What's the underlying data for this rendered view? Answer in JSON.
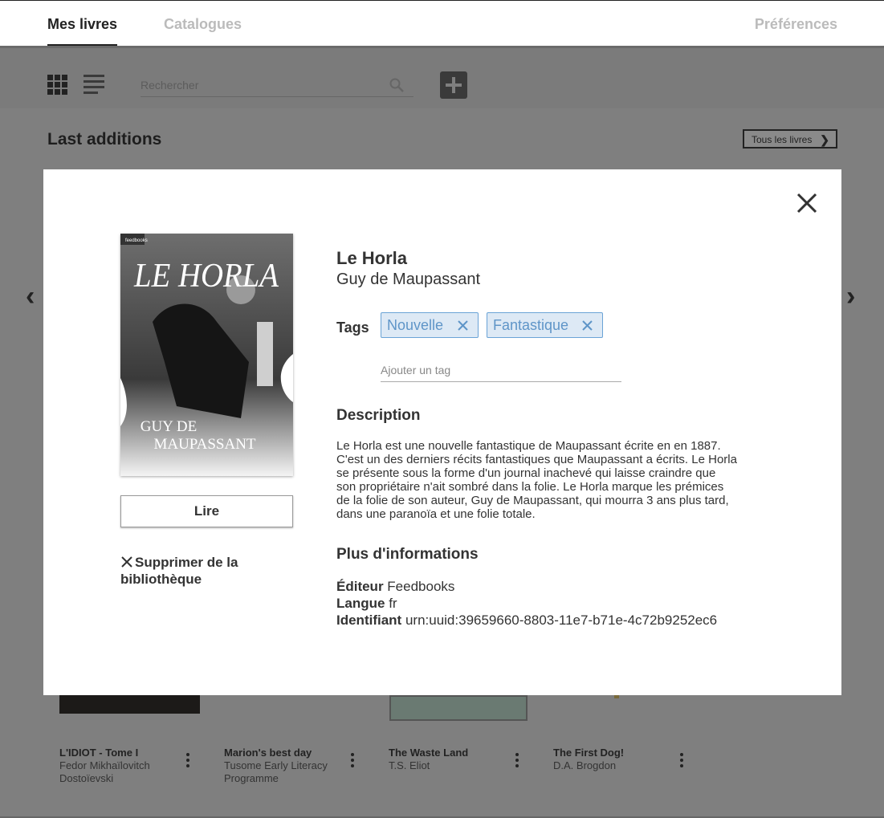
{
  "nav": {
    "tabs": [
      {
        "label": "Mes livres",
        "active": true
      },
      {
        "label": "Catalogues",
        "active": false
      }
    ],
    "preferences_label": "Préférences"
  },
  "toolbar": {
    "grid_view_icon": "grid-icon",
    "list_view_icon": "list-icon",
    "search_placeholder": "Rechercher",
    "search_icon": "search-icon",
    "add_icon": "plus-icon"
  },
  "section": {
    "title": "Last additions",
    "all_books_label": "Tous les livres"
  },
  "books": [
    {
      "title": "L'IDIOT - Tome I",
      "author": "Fedor Mikhaïlovitch Dostoïevski"
    },
    {
      "title": "Marion's best day",
      "author": "Tusome Early Literacy Programme"
    },
    {
      "title": "The Waste Land",
      "author": "T.S. Eliot"
    },
    {
      "title": "The First Dog!",
      "author": "D.A. Brogdon"
    }
  ],
  "modal": {
    "cover": {
      "title": "LE HORLA",
      "author_line1": "GUY DE",
      "author_line2": "MAUPASSANT",
      "publisher_badge": "feedbooks"
    },
    "read_label": "Lire",
    "remove_label": "Supprimer de la bibliothèque",
    "book_title": "Le Horla",
    "book_author": "Guy de Maupassant",
    "tags_label": "Tags",
    "tags": [
      "Nouvelle",
      "Fantastique"
    ],
    "add_tag_placeholder": "Ajouter un tag",
    "description_heading": "Description",
    "description": "Le Horla est une nouvelle fantastique de Maupassant écrite en en 1887. C'est un des derniers récits fantastiques que Maupassant a écrits. Le Horla se présente sous la forme d'un journal inachevé qui laisse craindre que son propriétaire n'ait sombré dans la folie. Le Horla marque les prémices de la folie de son auteur, Guy de Maupassant, qui mourra 3 ans plus tard, dans une paranoïa et une folie totale.",
    "more_info_heading": "Plus d'informations",
    "info": {
      "publisher_label": "Éditeur",
      "publisher": "Feedbooks",
      "language_label": "Langue",
      "language": "fr",
      "identifier_label": "Identifiant",
      "identifier": "urn:uuid:39659660-8803-11e7-b71e-4c72b9252ec6"
    }
  },
  "colors": {
    "overlay": "#7f7f7f",
    "tag_bg": "#dde9f5",
    "tag_border": "#6aa3d6",
    "tag_text": "#5f95c8"
  }
}
